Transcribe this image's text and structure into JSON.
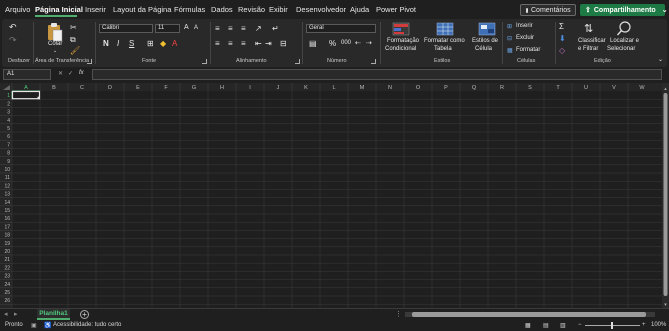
{
  "menu": {
    "tabs": [
      "Arquivo",
      "Página Inicial",
      "Inserir",
      "Layout da Página",
      "Fórmulas",
      "Dados",
      "Revisão",
      "Exibir",
      "Desenvolvedor",
      "Ajuda",
      "Power Pivot"
    ],
    "active": "Página Inicial",
    "comments_label": "Comentários",
    "share_label": "Compartilhamento"
  },
  "ribbon": {
    "undo_group_label": "Desfazer",
    "clipboard": {
      "paste_label": "Colar",
      "group_label": "Área de Transferência"
    },
    "font": {
      "name": "Calibri",
      "size": "11",
      "group_label": "Fonte",
      "bold": "N",
      "italic": "I",
      "underline": "S",
      "grow": "A",
      "shrink": "A"
    },
    "alignment": {
      "group_label": "Alinhamento"
    },
    "number": {
      "format": "Geral",
      "group_label": "Número",
      "percent": "%",
      "thousands": "000"
    },
    "styles": {
      "group_label": "Estilos",
      "conditional_l1": "Formatação",
      "conditional_l2": "Condicional",
      "table_l1": "Formatar como",
      "table_l2": "Tabela",
      "cell_l1": "Estilos de",
      "cell_l2": "Célula"
    },
    "cells": {
      "group_label": "Células",
      "insert": "Inserir",
      "delete": "Excluir",
      "format": "Formatar"
    },
    "editing": {
      "group_label": "Edição",
      "sort_l1": "Classificar",
      "sort_l2": "e Filtrar",
      "find_l1": "Localizar e",
      "find_l2": "Selecionar"
    }
  },
  "formula_bar": {
    "name_box": "A1",
    "fx": "fx",
    "value": ""
  },
  "grid": {
    "columns": [
      "A",
      "B",
      "C",
      "D",
      "E",
      "F",
      "G",
      "H",
      "I",
      "J",
      "K",
      "L",
      "M",
      "N",
      "O",
      "P",
      "Q",
      "R",
      "S",
      "T",
      "U",
      "V",
      "W"
    ],
    "row_count": 26,
    "selected_cell": "A1"
  },
  "sheets": {
    "tabs": [
      "Planilha1"
    ],
    "active": "Planilha1",
    "add": "+"
  },
  "status": {
    "ready": "Pronto",
    "accessibility": "Acessibilidade: tudo certo",
    "zoom": "100%"
  },
  "colors": {
    "accent": "#4fae6e",
    "share_bg": "#1e7a44",
    "background": "#1f1f1f",
    "gridline": "#3b3b3b"
  }
}
